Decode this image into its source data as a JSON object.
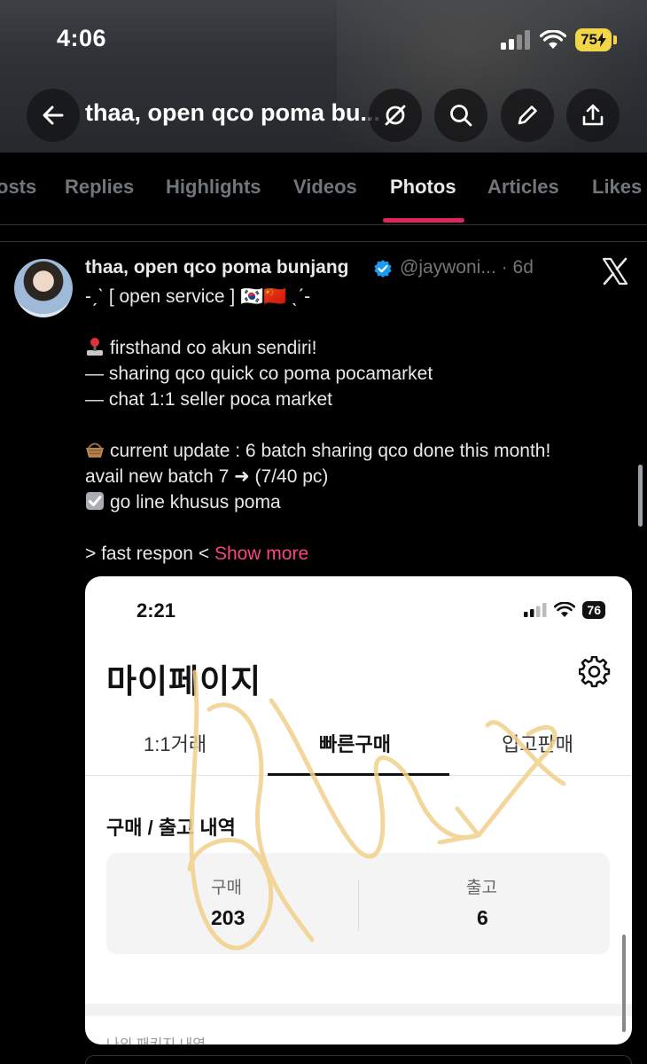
{
  "status_bar": {
    "time": "4:06",
    "battery": "75"
  },
  "header": {
    "title": "thaa, open qco poma bu..."
  },
  "tabs": [
    {
      "label": "osts"
    },
    {
      "label": "Replies"
    },
    {
      "label": "Highlights"
    },
    {
      "label": "Videos"
    },
    {
      "label": "Photos"
    },
    {
      "label": "Articles"
    },
    {
      "label": "Likes"
    }
  ],
  "post": {
    "author_name": "thaa, open qco poma bunjang",
    "handle_time": "@jaywoni... · 6d",
    "lines": [
      "-ˏˋ [ open service ] 🇰🇷🇨🇳 ˎˊ-",
      "",
      "firsthand co akun sendiri!",
      "— sharing qco quick co poma pocamarket",
      "— chat 1:1 seller poca market",
      "",
      "current update : 6 batch sharing qco done this month!",
      "avail new batch 7 ➜ (7/40 pc)",
      "go line khusus poma",
      "",
      "> fast respon < "
    ],
    "show_more": "Show more"
  },
  "photo": {
    "time": "2:21",
    "battery": "76",
    "title": "마이페이지",
    "tabs": [
      "1:1거래",
      "빠른구매",
      "입고판매"
    ],
    "section": "구매 / 출고 내역",
    "stats": [
      {
        "label": "구매",
        "value": "203"
      },
      {
        "label": "출고",
        "value": "6"
      }
    ],
    "bottom_text": "나의 패키지 내역"
  },
  "colors": {
    "accent_pink": "#f9457d",
    "tab_underline": "#e0245e",
    "verified": "#1d9bf0",
    "battery_yellow": "#f5d548"
  },
  "icons": [
    "back-arrow-icon",
    "hide-icon",
    "search-icon",
    "edit-icon",
    "share-icon",
    "verified-badge-icon",
    "x-logo-icon",
    "gear-icon"
  ]
}
